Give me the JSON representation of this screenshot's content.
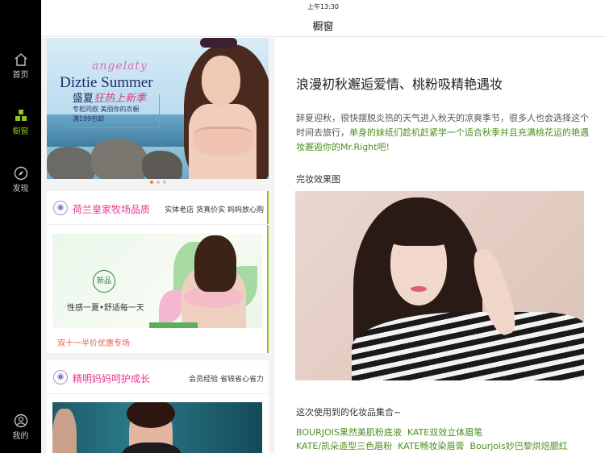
{
  "status_bar": {
    "time": "上午13:30"
  },
  "header": {
    "title": "橱窗"
  },
  "sidebar": {
    "items": [
      {
        "label": "首页",
        "icon": "home-icon"
      },
      {
        "label": "橱窗",
        "icon": "showcase-icon",
        "active": true
      },
      {
        "label": "发现",
        "icon": "compass-icon"
      },
      {
        "label": "我的",
        "icon": "user-icon"
      }
    ]
  },
  "banner": {
    "script_text": "angelaty",
    "headline": "Diztie Summer",
    "line1_a": "盛夏",
    "line1_b": "狂热上新季",
    "line2": "专柜同款 美丽你的衣橱",
    "line3": "满199包邮",
    "active_dot": 1
  },
  "cards": [
    {
      "logo_text": "◉",
      "title": "荷兰皇家牧场品质",
      "tags": "实体老店  货真价实  妈妈放心购",
      "badge": "新品",
      "slogan": "性感一夏•舒适每一天",
      "caption": "双十一半价优惠专场"
    },
    {
      "logo_text": "◉",
      "title": "精明妈妈呵护成长",
      "tags": "会员经验  省钱省心省力"
    }
  ],
  "article": {
    "title": "浪漫初秋邂逅爱情、桃粉吸精艳遇妆",
    "body_plain": "辞夏迎秋，很快摆脱炎热的天气进入秋天的凉爽季节，很多人也会选择这个时间去旅行，",
    "body_highlight": "单身的妹纸们趁机赶紧学一个适合秋季并且充满桃花运的艳遇妆邂逅你的Mr.Right吧!",
    "image_label": "完妆效果图",
    "products_label": "这次使用到的化妆品集合~",
    "products_line1": [
      "BOURJOIS果然美肌粉底液",
      "KATE双效立体眉笔"
    ],
    "products_line2": [
      "KATE/凯朵造型三色眉粉",
      "KATE畅妆染眉膏",
      "Bourjois妙巴黎烘焙腮红"
    ]
  },
  "colors": {
    "accent_green": "#8fc31f",
    "pink": "#e6388a",
    "promo_red": "#f15a4f",
    "sidebar_bg": "#000000"
  }
}
